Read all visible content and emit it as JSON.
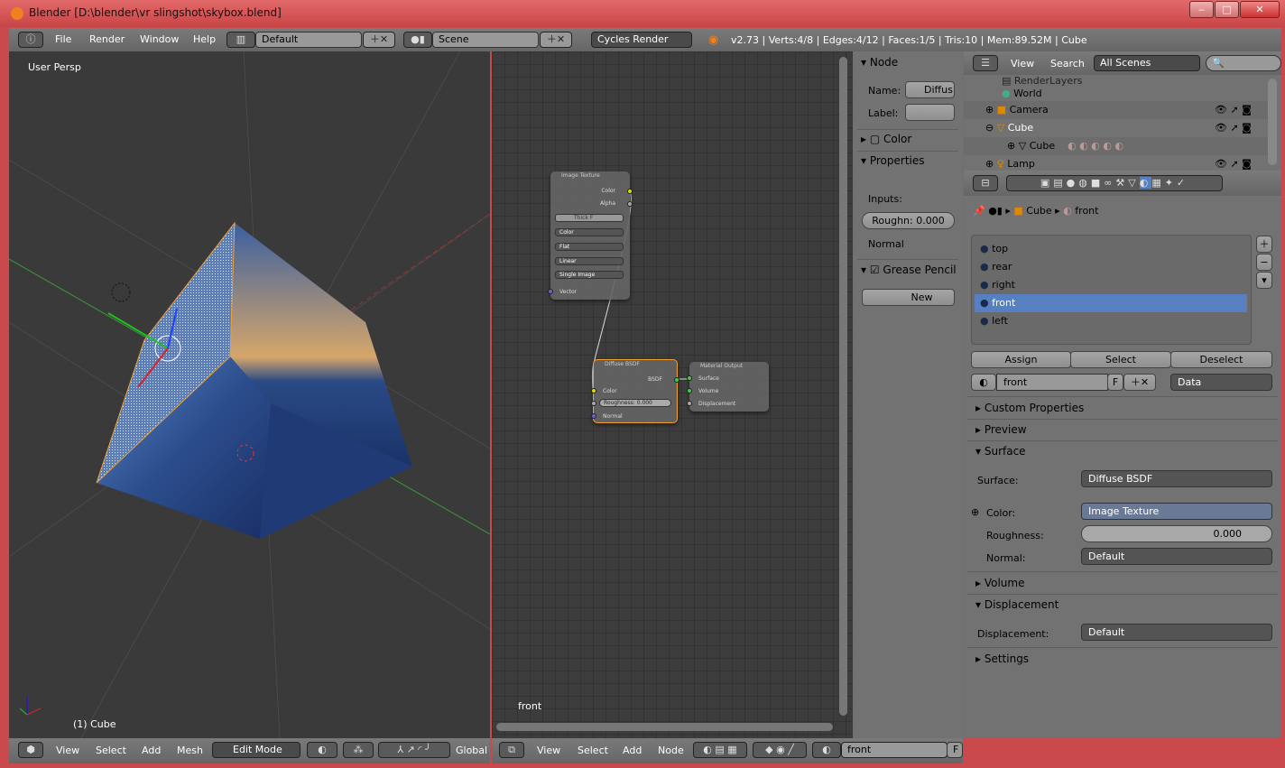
{
  "window": {
    "title": "Blender [D:\\blender\\vr slingshot\\skybox.blend]",
    "controls": [
      "minimize",
      "maximize",
      "close"
    ]
  },
  "info_header": {
    "menus": [
      "File",
      "Render",
      "Window",
      "Help"
    ],
    "layout": "Default",
    "scene": "Scene",
    "engine": "Cycles Render",
    "stats": "v2.73 | Verts:4/8 | Edges:4/12 | Faces:1/5 | Tris:10 | Mem:89.52M | Cube"
  },
  "viewport": {
    "view_label": "User Persp",
    "object_label": "(1) Cube",
    "header": {
      "menus": [
        "View",
        "Select",
        "Add",
        "Mesh"
      ],
      "mode": "Edit Mode",
      "orientation": "Global"
    }
  },
  "node_editor": {
    "material_label": "front",
    "nodes": {
      "image_texture": {
        "title": "Image Texture",
        "outputs": [
          "Color",
          "Alpha"
        ],
        "image": "Thick",
        "fake": "F",
        "color_space": "Color",
        "projection": "Flat",
        "interpolation": "Linear",
        "source": "Single Image",
        "input": "Vector"
      },
      "diffuse": {
        "title": "Diffuse BSDF",
        "output": "BSDF",
        "inputs": [
          "Color",
          "Normal"
        ],
        "roughness": "Roughness:",
        "roughness_value": "0.000"
      },
      "output": {
        "title": "Material Output",
        "inputs": [
          "Surface",
          "Volume",
          "Displacement"
        ]
      }
    },
    "header": {
      "menus": [
        "View",
        "Select",
        "Add",
        "Node"
      ],
      "material": "front",
      "fake": "F"
    }
  },
  "npanel": {
    "node_title": "Node",
    "name_label": "Name:",
    "name_value": "Diffus",
    "label_label": "Label:",
    "label_value": "",
    "color": "Color",
    "properties": "Properties",
    "inputs": "Inputs:",
    "roughness": "Roughn: 0.000",
    "normal": "Normal",
    "grease": "Grease Pencil",
    "new": "New"
  },
  "outliner": {
    "menus": [
      "View",
      "Search"
    ],
    "filter": "All Scenes",
    "items": [
      {
        "label": "RenderLayers"
      },
      {
        "label": "World"
      },
      {
        "label": "Camera"
      },
      {
        "label": "Cube"
      },
      {
        "label": "Cube"
      },
      {
        "label": "Lamp"
      }
    ]
  },
  "properties": {
    "breadcrumb": [
      "Cube",
      "front"
    ],
    "slots": [
      "top",
      "rear",
      "right",
      "front",
      "left"
    ],
    "selected_slot": "front",
    "assign": "Assign",
    "select": "Select",
    "deselect": "Deselect",
    "material": "front",
    "fake": "F",
    "link": "Data",
    "panels": {
      "custom": "Custom Properties",
      "preview": "Preview",
      "surface": "Surface",
      "volume": "Volume",
      "displacement": "Displacement",
      "settings": "Settings"
    },
    "surface_label": "Surface:",
    "surface_value": "Diffuse BSDF",
    "color_label": "Color:",
    "color_value": "Image Texture",
    "roughness_label": "Roughness:",
    "roughness_value": "0.000",
    "normal_label": "Normal:",
    "normal_value": "Default",
    "disp_label": "Displacement:",
    "disp_value": "Default"
  },
  "colors": {
    "selection": "#5680c2",
    "title_bar": "#d05050",
    "header": "#727272"
  }
}
